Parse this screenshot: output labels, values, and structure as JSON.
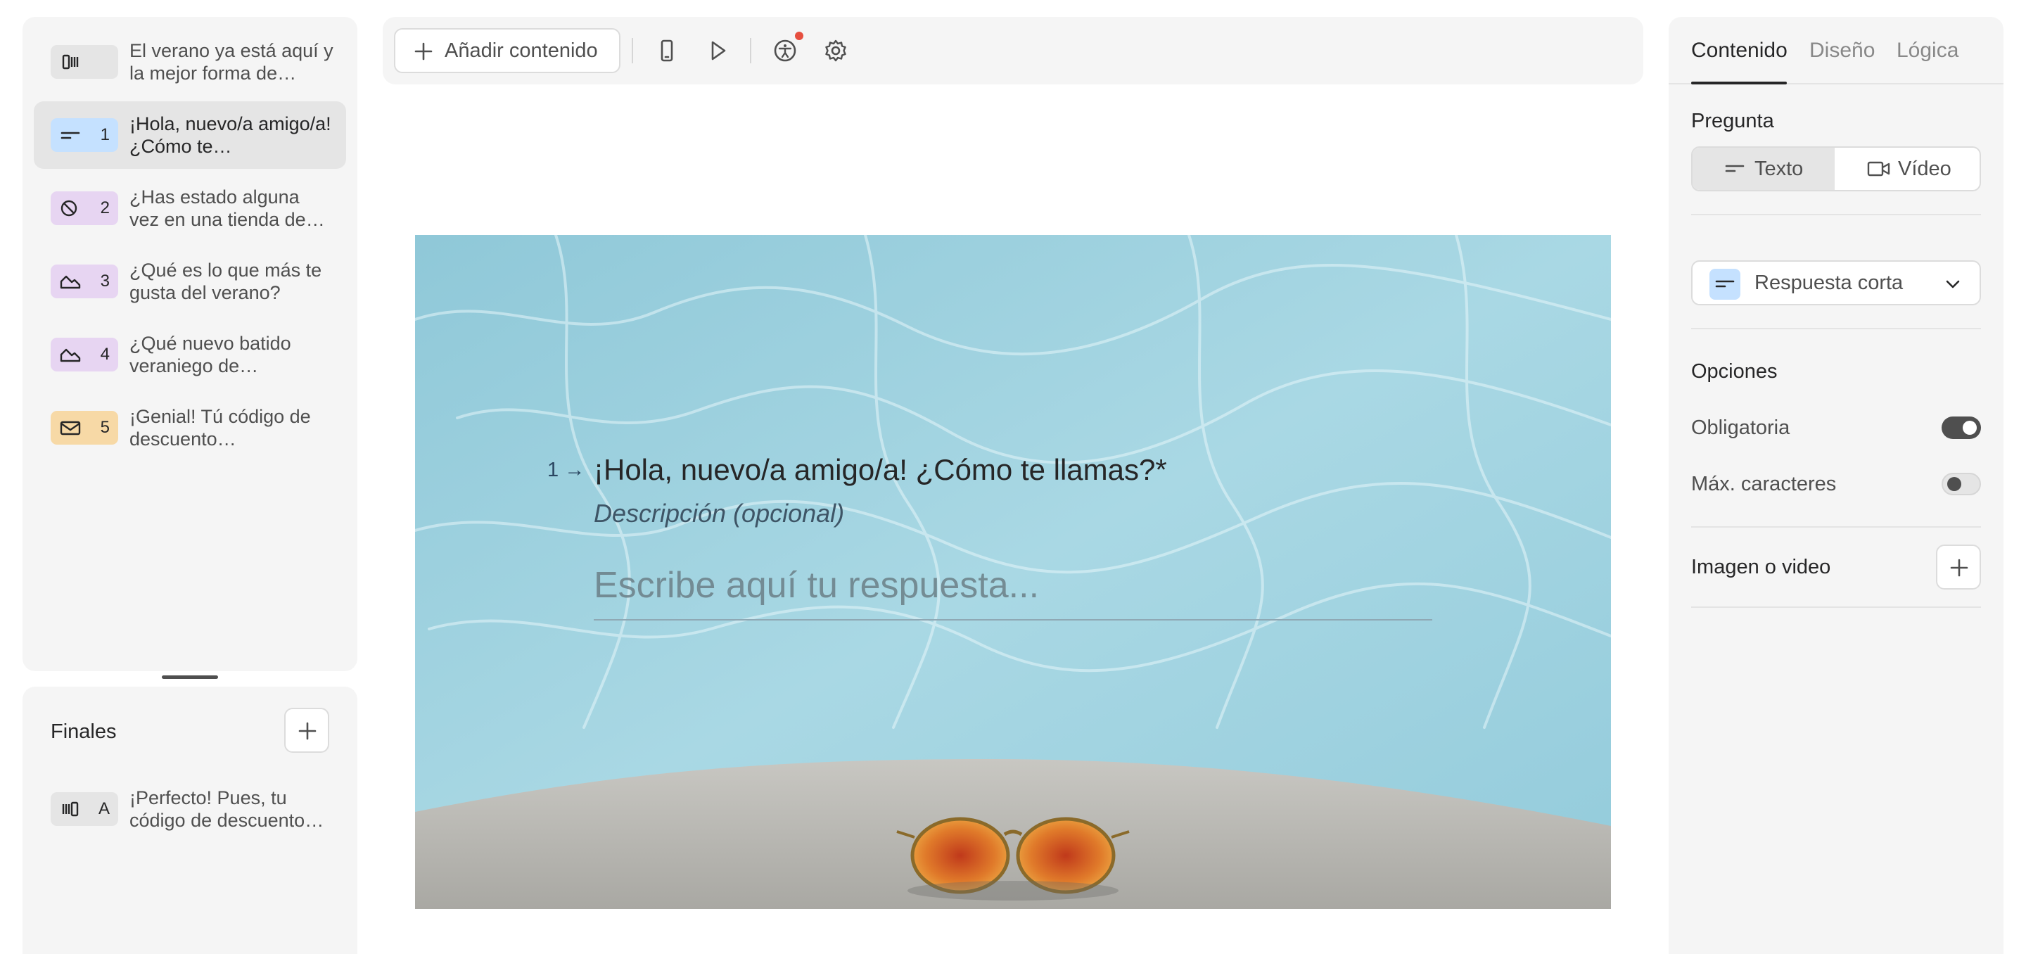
{
  "sidebar": {
    "welcome": {
      "text": "El verano ya está aquí y la mejor forma de…",
      "color": "#e5e5e5"
    },
    "questions": [
      {
        "number": "1",
        "text": "¡Hola, nuevo/a amigo/a! ¿Cómo te…",
        "icon": "short-text-icon",
        "color": "#c5e1ff",
        "active": true
      },
      {
        "number": "2",
        "text": "¿Has estado alguna vez en una tienda de…",
        "icon": "slash-circle-icon",
        "color": "#e7d5f2",
        "active": false
      },
      {
        "number": "3",
        "text": "¿Qué es lo que más te gusta del verano?",
        "icon": "picture-choice-icon",
        "color": "#e7d5f2",
        "active": false
      },
      {
        "number": "4",
        "text": "¿Qué nuevo batido veraniego de…",
        "icon": "picture-choice-icon",
        "color": "#e7d5f2",
        "active": false
      },
      {
        "number": "5",
        "text": "¡Genial! Tú código de descuento…",
        "icon": "mail-icon",
        "color": "#f7d9a6",
        "active": false
      }
    ],
    "endings_title": "Finales",
    "endings": [
      {
        "letter": "A",
        "text": "¡Perfecto! Pues, tu código de descuento…",
        "color": "#e5e5e5"
      }
    ]
  },
  "toolbar": {
    "add_content_label": "Añadir contenido"
  },
  "canvas": {
    "question_number": "1",
    "question_title": "¡Hola, nuevo/a amigo/a! ¿Cómo te llamas?*",
    "description_placeholder": "Descripción (opcional)",
    "answer_placeholder": "Escribe aquí tu respuesta..."
  },
  "settings": {
    "tabs": [
      "Contenido",
      "Diseño",
      "Lógica"
    ],
    "active_tab": "Contenido",
    "question_label": "Pregunta",
    "question_modes": [
      "Texto",
      "Vídeo"
    ],
    "selected_mode": "Texto",
    "question_type": "Respuesta corta",
    "options_label": "Opciones",
    "required_label": "Obligatoria",
    "required_on": true,
    "max_chars_label": "Máx. caracteres",
    "max_chars_on": false,
    "media_label": "Imagen o video"
  },
  "colors": {
    "accent_dark": "#262627",
    "panel_bg": "#f5f5f5",
    "notification_dot": "#e64f3f"
  }
}
